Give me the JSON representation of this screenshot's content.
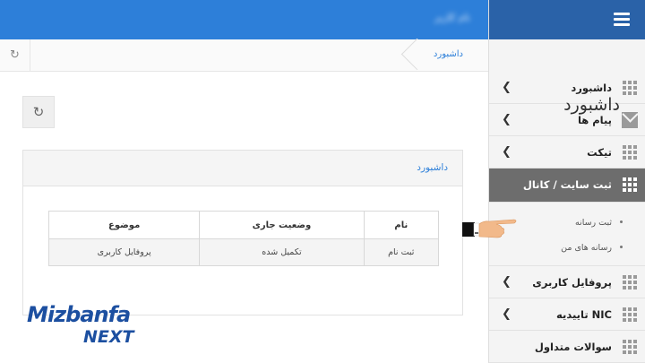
{
  "topbar": {
    "user_label": "نام کاربر"
  },
  "breadcrumb": {
    "current": "داشبورد"
  },
  "page": {
    "title": "داشبورد"
  },
  "panel": {
    "title": "داشبورد",
    "table": {
      "headers": [
        "نام",
        "وضعیت جاری",
        "موضوع"
      ],
      "rows": [
        [
          "ثبت نام",
          "تکمیل شده",
          "پروفایل کاربری"
        ]
      ]
    }
  },
  "sidebar": {
    "items": [
      {
        "label": "داشبورد",
        "icon": "grid-icon"
      },
      {
        "label": "پیام ها",
        "icon": "mail-icon"
      },
      {
        "label": "تیکت",
        "icon": "grid-icon"
      },
      {
        "label": "ثبت سایت / کانال",
        "icon": "grid-icon",
        "active": true
      },
      {
        "label": "پروفایل کاربری",
        "icon": "grid-icon"
      },
      {
        "label": "تاییدیه NIC",
        "icon": "grid-icon"
      },
      {
        "label": "سوالات متداول",
        "icon": "grid-icon"
      }
    ],
    "subitems": [
      {
        "label": "ثبت رسانه"
      },
      {
        "label": "رسانه های من"
      }
    ]
  },
  "logo": {
    "line1": "Mizbanfa",
    "line2": "NEXT"
  },
  "colors": {
    "topbar": "#2d7fd9",
    "sidebar_head": "#2a62a8",
    "active_item": "#6d6d6d",
    "link": "#2d7fd9",
    "logo": "#1c4fa0"
  }
}
